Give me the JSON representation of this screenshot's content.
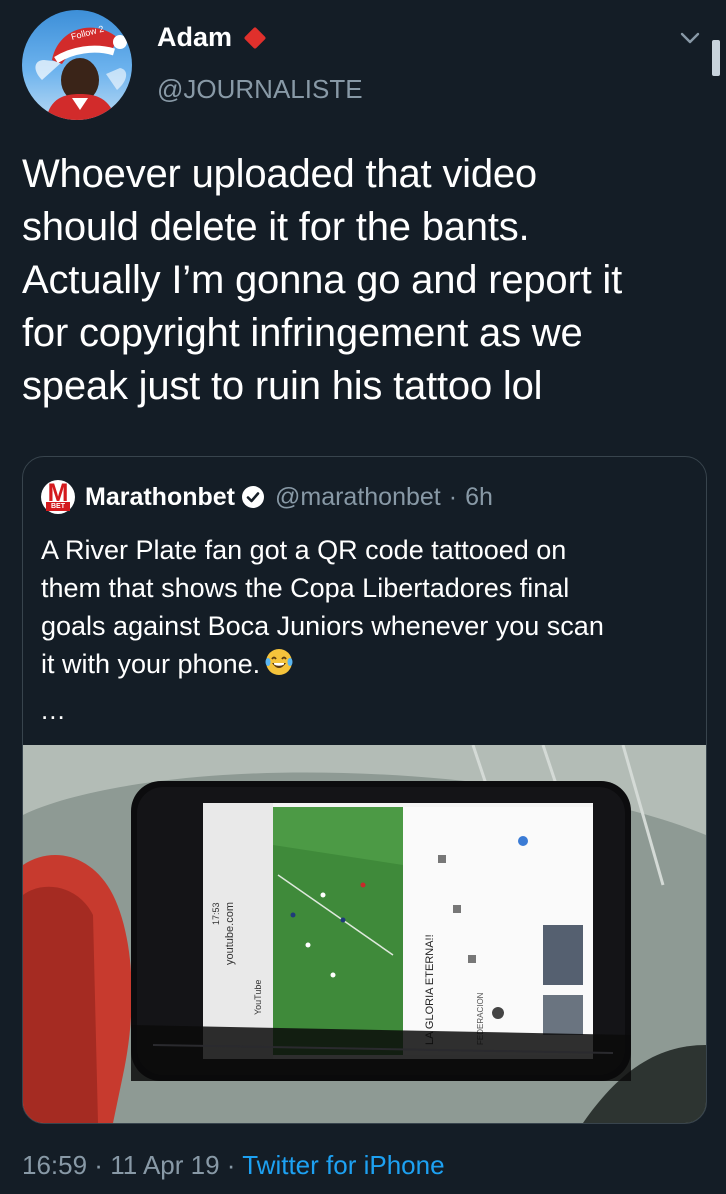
{
  "author": {
    "name": "Adam",
    "handle": "@JOURNALISTE",
    "avatar_hat_text": "Follow 2"
  },
  "tweet": {
    "text": "Whoever uploaded that video\nshould delete it for the bants.\nActually I’m gonna go and report it\nfor copyright infringement as we\nspeak just to ruin his tattoo lol"
  },
  "quote": {
    "logo_letter": "M",
    "logo_sub": "BET",
    "name": "Marathonbet",
    "handle": "@marathonbet",
    "separator": "·",
    "time": "6h",
    "text": "A River Plate fan got a QR code tattooed on\nthem that shows the Copa Libertadores final\ngoals against Boca Juniors whenever you scan\nit with your phone.",
    "more": "...",
    "media": {
      "url_text": "youtube.com",
      "clock": "17:53",
      "app_label": "YouTube",
      "video_title": "LA GLORIA ETERNA!!",
      "channel": "FEDERACION"
    }
  },
  "footer": {
    "time": "16:59",
    "sep1": " · ",
    "date": "11 Apr 19",
    "sep2": " · ",
    "source": "Twitter for iPhone"
  }
}
